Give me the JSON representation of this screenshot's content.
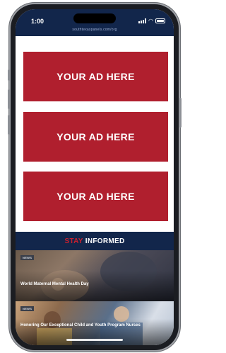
{
  "status_bar": {
    "time": "1:00",
    "url": "southtexaspanels.com/org"
  },
  "ads": [
    {
      "label": "YOUR AD HERE"
    },
    {
      "label": "YOUR AD HERE"
    },
    {
      "label": "YOUR AD HERE"
    }
  ],
  "stay_informed": {
    "word_red": "STAY",
    "word_white": "INFORMED"
  },
  "news": [
    {
      "tag": "NEWS",
      "headline": "World Maternal Mental Health Day"
    },
    {
      "tag": "NEWS",
      "headline": "Honoring Our Exceptional Child and Youth Program Nurses"
    }
  ],
  "colors": {
    "navy": "#12264b",
    "ad_red": "#b01f2e",
    "accent_red": "#c8202f"
  }
}
